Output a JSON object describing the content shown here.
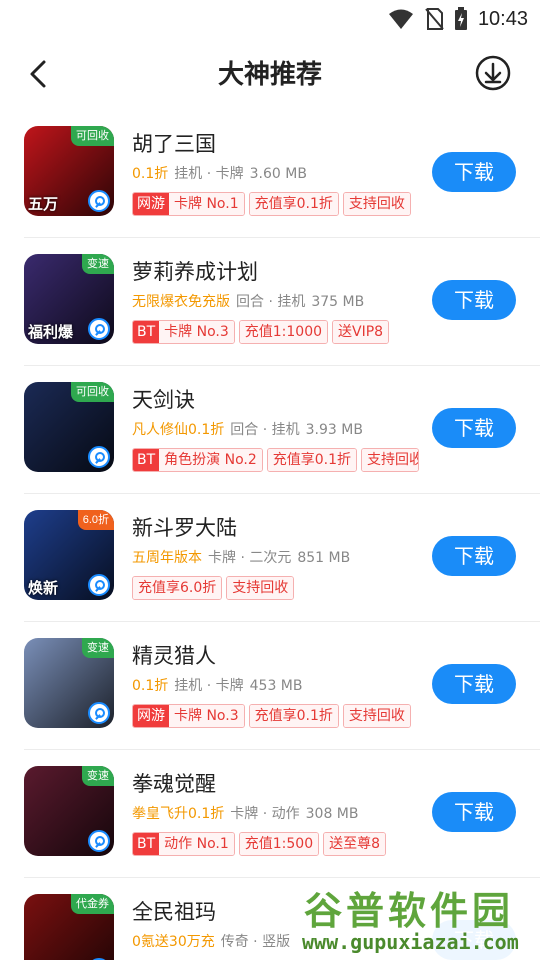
{
  "status_bar": {
    "time": "10:43",
    "icons": [
      "wifi-icon",
      "no-sim-icon",
      "battery-charging-icon"
    ]
  },
  "header": {
    "title": "大神推荐",
    "back_icon": "chevron-left-icon",
    "download_icon": "download-circle-icon"
  },
  "games": [
    {
      "name": "胡了三国",
      "promo": "0.1折",
      "category": "挂机 · 卡牌",
      "size": "3.60 MB",
      "icon": {
        "badge": "可回收",
        "badge_color": "#2fa84f",
        "caption": "五万",
        "bg": "#c0151b"
      },
      "tags": [
        {
          "type": "",
          "text": "网游",
          "label": "卡牌 No.1"
        },
        {
          "text": "充值享0.1折"
        },
        {
          "text": "支持回收"
        }
      ],
      "button": "下载"
    },
    {
      "name": "萝莉养成计划",
      "promo": "无限爆衣免充版",
      "category": "回合 · 挂机",
      "size": "375 MB",
      "icon": {
        "badge": "变速",
        "badge_color": "#2fa84f",
        "caption": "福利爆",
        "bg": "#3a2a6e"
      },
      "tags": [
        {
          "type": "BT",
          "label": "卡牌 No.3"
        },
        {
          "text": "充值1:1000"
        },
        {
          "text": "送VIP8"
        }
      ],
      "button": "下载"
    },
    {
      "name": "天剑诀",
      "promo": "凡人修仙0.1折",
      "category": "回合 · 挂机",
      "size": "3.93 MB",
      "icon": {
        "badge": "可回收",
        "badge_color": "#2fa84f",
        "caption": "",
        "bg": "#1b2a55"
      },
      "tags": [
        {
          "type": "BT",
          "label": "角色扮演 No.2"
        },
        {
          "text": "充值享0.1折"
        },
        {
          "text": "支持回收"
        }
      ],
      "button": "下载"
    },
    {
      "name": "新斗罗大陆",
      "promo": "五周年版本",
      "category": "卡牌 · 二次元",
      "size": "851 MB",
      "icon": {
        "badge": "6.0折",
        "badge_color": "#f0611d",
        "caption": "焕新",
        "bg": "#1e3e8c"
      },
      "tags": [
        {
          "text": "充值享6.0折"
        },
        {
          "text": "支持回收"
        }
      ],
      "button": "下载"
    },
    {
      "name": "精灵猎人",
      "promo": "0.1折",
      "category": "挂机 · 卡牌",
      "size": "453 MB",
      "icon": {
        "badge": "变速",
        "badge_color": "#2fa84f",
        "caption": "",
        "bg": "#7a8fb8"
      },
      "tags": [
        {
          "type": "网游",
          "label": "卡牌 No.3"
        },
        {
          "text": "充值享0.1折"
        },
        {
          "text": "支持回收"
        }
      ],
      "button": "下载"
    },
    {
      "name": "拳魂觉醒",
      "promo": "拳皇飞升0.1折",
      "category": "卡牌 · 动作",
      "size": "308 MB",
      "icon": {
        "badge": "变速",
        "badge_color": "#2fa84f",
        "caption": "",
        "bg": "#5a1a2e"
      },
      "tags": [
        {
          "type": "BT",
          "label": "动作 No.1"
        },
        {
          "text": "充值1:500"
        },
        {
          "text": "送至尊8"
        }
      ],
      "button": "下载"
    },
    {
      "name": "全民祖玛",
      "promo": "0氪送30万充",
      "category": "传奇 · 竖版",
      "size": "",
      "icon": {
        "badge": "代金券",
        "badge_color": "#2fa84f",
        "caption": "",
        "bg": "#7a1010"
      },
      "tags": [],
      "button": "下载"
    }
  ],
  "watermark": {
    "main": "谷普软件园",
    "url": "www.gupuxiazai.com"
  }
}
